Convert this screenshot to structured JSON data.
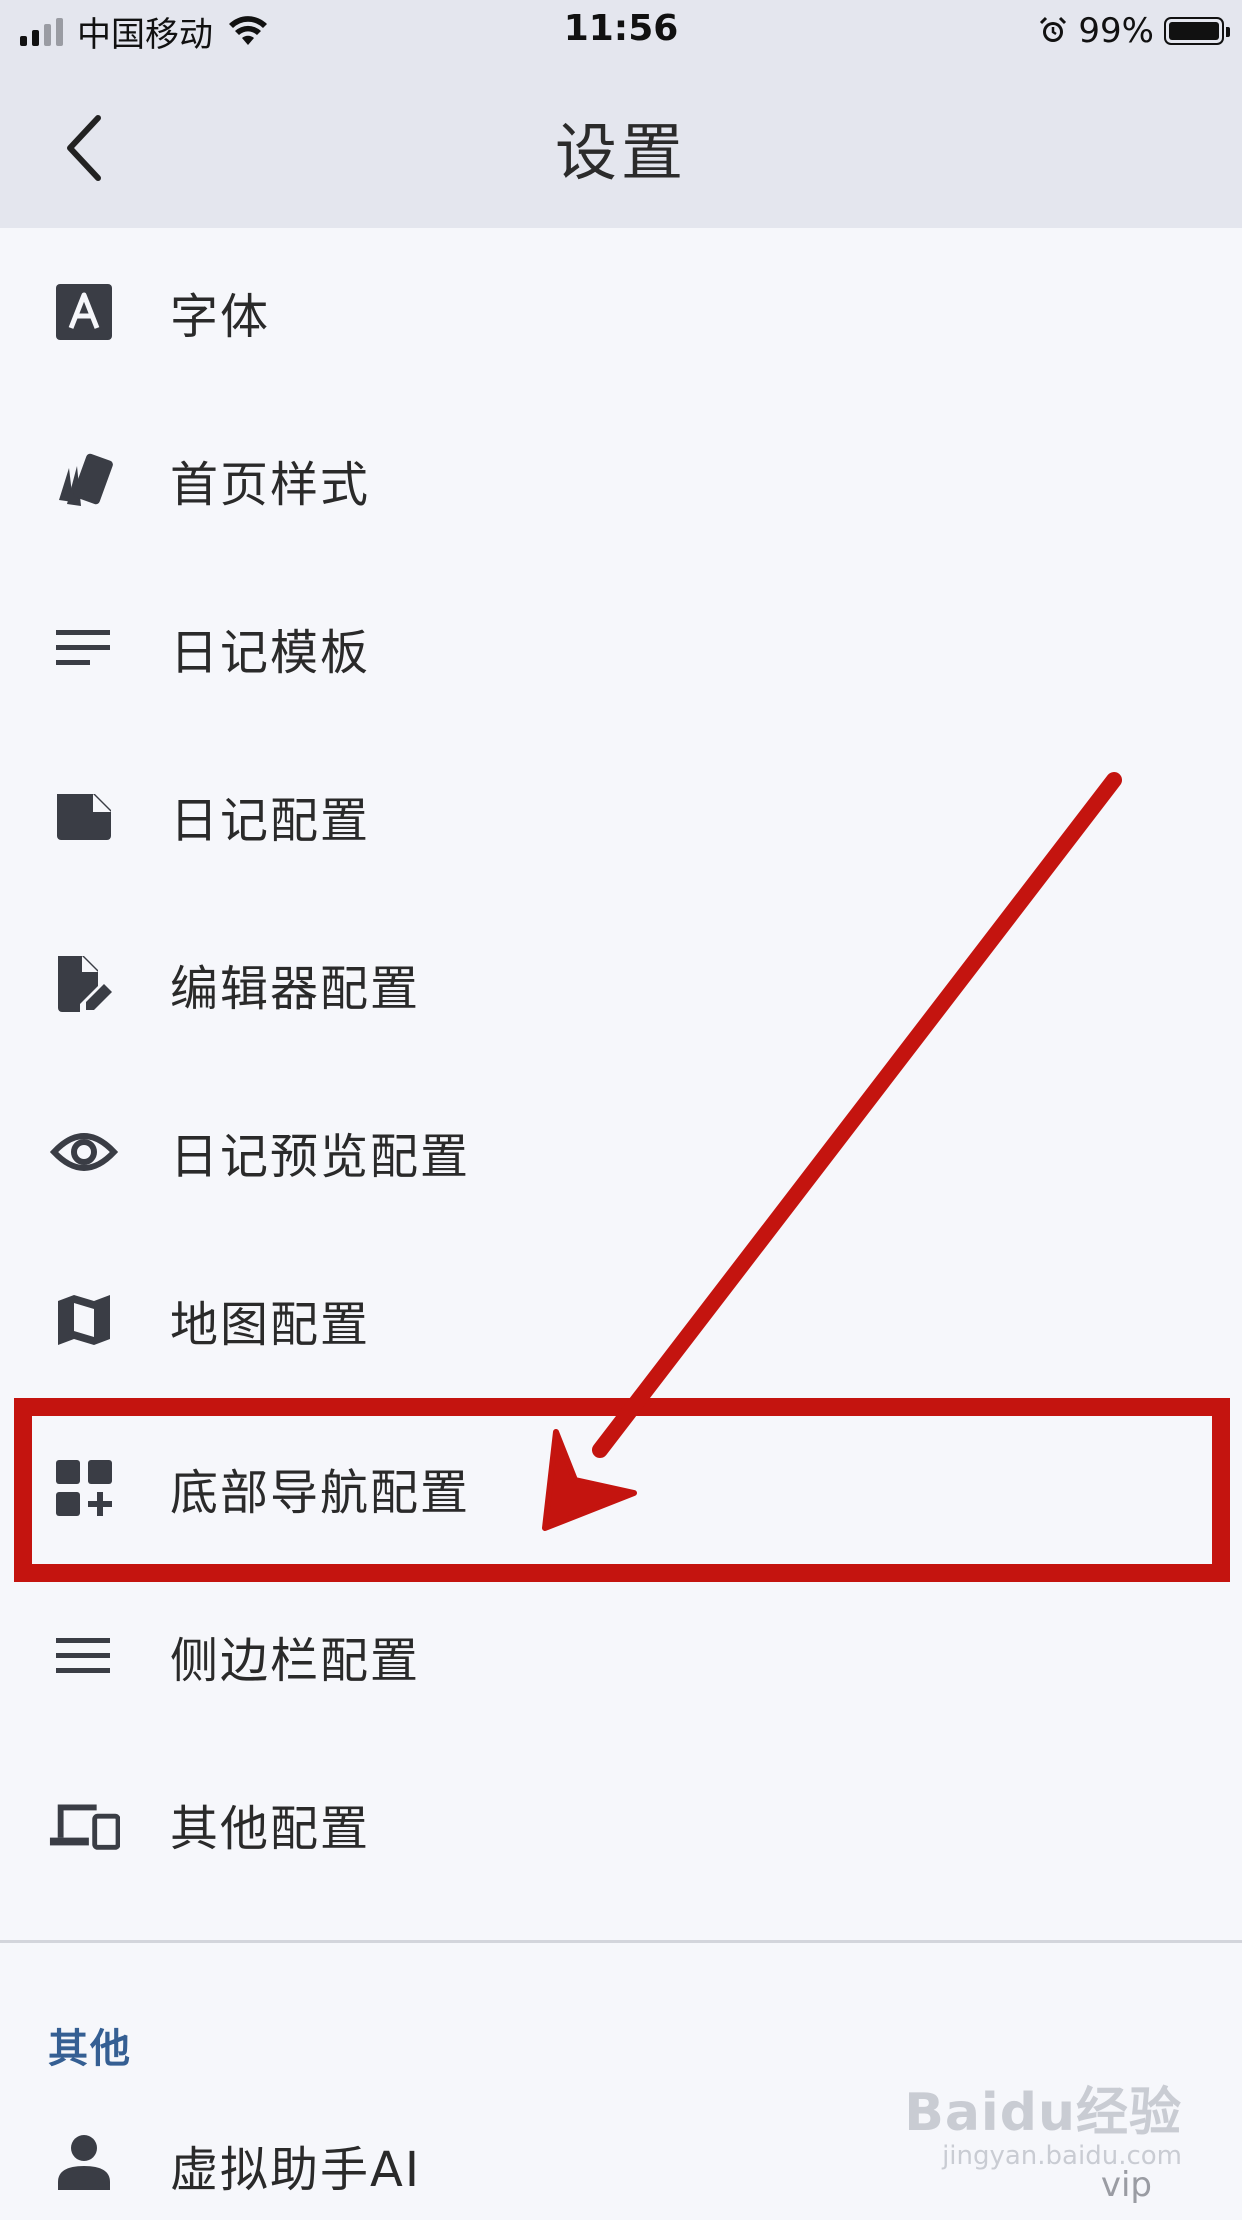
{
  "status_bar": {
    "carrier": "中国移动",
    "time": "11:56",
    "battery_percent": "99%",
    "battery_level": 0.99,
    "signal_bars": 4,
    "signal_active": 2
  },
  "nav": {
    "title": "设置",
    "back_icon": "chevron-left-icon"
  },
  "settings_items": [
    {
      "label": "字体",
      "icon": "font-icon"
    },
    {
      "label": "首页样式",
      "icon": "style-icon"
    },
    {
      "label": "日记模板",
      "icon": "template-icon"
    },
    {
      "label": "日记配置",
      "icon": "note-icon"
    },
    {
      "label": "编辑器配置",
      "icon": "edit-file-icon"
    },
    {
      "label": "日记预览配置",
      "icon": "eye-icon"
    },
    {
      "label": "地图配置",
      "icon": "map-icon"
    },
    {
      "label": "底部导航配置",
      "icon": "dashboard-add-icon"
    },
    {
      "label": "侧边栏配置",
      "icon": "menu-icon"
    },
    {
      "label": "其他配置",
      "icon": "devices-icon"
    }
  ],
  "other_section": {
    "header": "其他",
    "items": [
      {
        "label": "虚拟助手AI",
        "icon": "person-icon"
      }
    ]
  },
  "annotation": {
    "highlighted_item": "底部导航配置",
    "color": "#c4140f"
  },
  "watermark": {
    "logo": "Baidu经验",
    "url": "jingyan.baidu.com",
    "tag": "vip"
  },
  "colors": {
    "background": "#f6f7fb",
    "bar": "#e4e6ee",
    "icon": "#3a3d45",
    "section_header": "#355f93"
  }
}
